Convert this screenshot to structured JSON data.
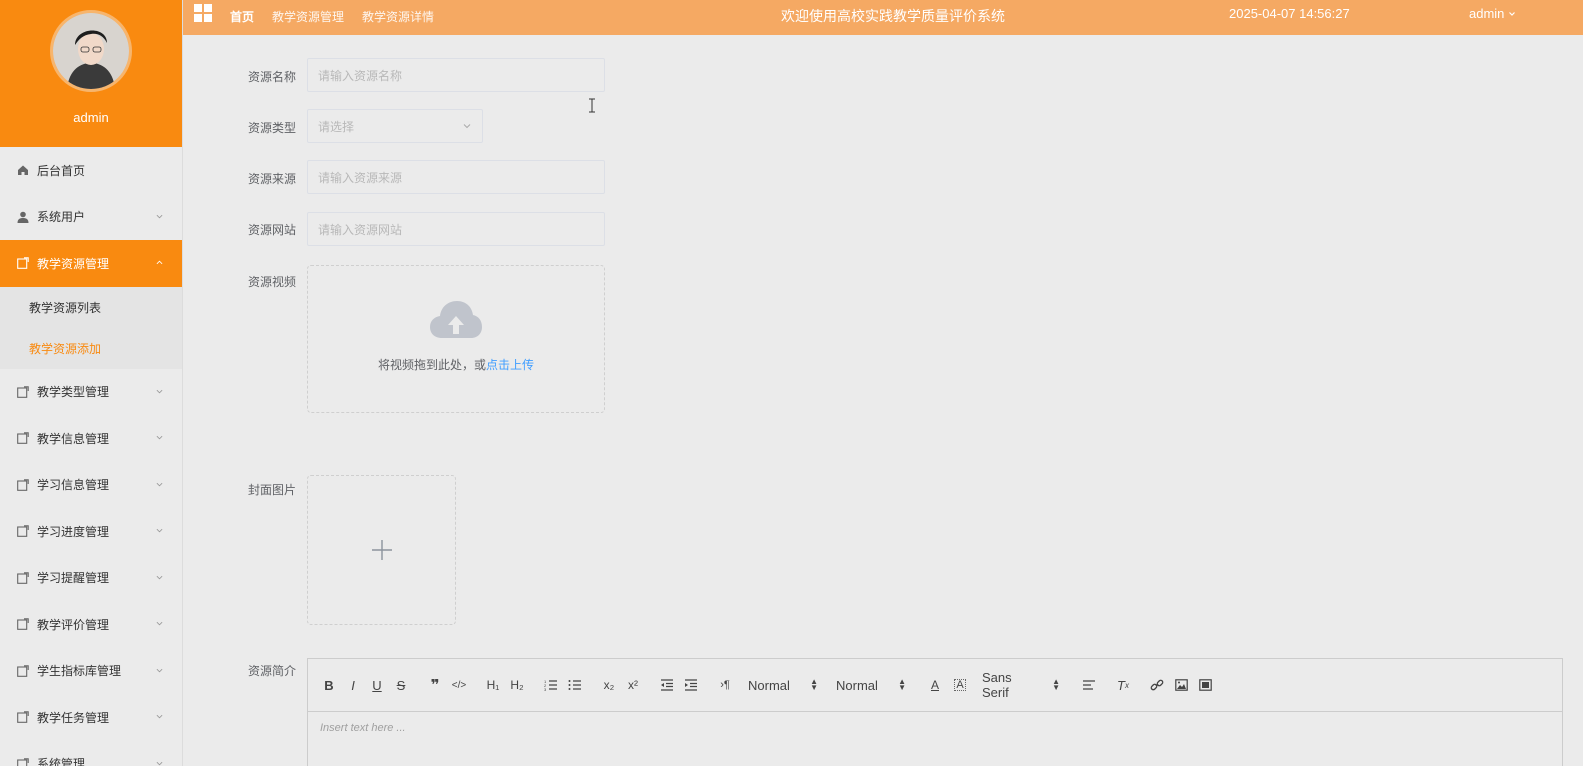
{
  "sidebar": {
    "username": "admin",
    "menu": [
      {
        "label": "后台首页",
        "icon": "home-icon"
      },
      {
        "label": "系统用户",
        "icon": "user-icon"
      },
      {
        "label": "教学资源管理",
        "icon": "edit-icon",
        "active": true,
        "submenu": [
          {
            "label": "教学资源列表"
          },
          {
            "label": "教学资源添加",
            "current": true
          }
        ]
      },
      {
        "label": "教学类型管理",
        "icon": "edit-icon"
      },
      {
        "label": "教学信息管理",
        "icon": "edit-icon"
      },
      {
        "label": "学习信息管理",
        "icon": "edit-icon"
      },
      {
        "label": "学习进度管理",
        "icon": "edit-icon"
      },
      {
        "label": "学习提醒管理",
        "icon": "edit-icon"
      },
      {
        "label": "教学评价管理",
        "icon": "edit-icon"
      },
      {
        "label": "学生指标库管理",
        "icon": "edit-icon"
      },
      {
        "label": "教学任务管理",
        "icon": "edit-icon"
      },
      {
        "label": "系统管理",
        "icon": "edit-icon"
      }
    ]
  },
  "topbar": {
    "breadcrumbs": [
      "首页",
      "教学资源管理",
      "教学资源详情"
    ],
    "title": "欢迎使用高校实践教学质量评价系统",
    "datetime": "2025-04-07 14:56:27",
    "user": "admin"
  },
  "form": {
    "name_label": "资源名称",
    "name_placeholder": "请输入资源名称",
    "type_label": "资源类型",
    "type_placeholder": "请选择",
    "source_label": "资源来源",
    "source_placeholder": "请输入资源来源",
    "site_label": "资源网站",
    "site_placeholder": "请输入资源网站",
    "video_label": "资源视频",
    "upload_hint": "将视频拖到此处，或",
    "upload_link": "点击上传",
    "cover_label": "封面图片",
    "intro_label": "资源简介"
  },
  "editor": {
    "header_select": "Normal",
    "size_select": "Normal",
    "font_select": "Sans Serif",
    "placeholder": "Insert text here ..."
  },
  "colors": {
    "accent": "#f98a10",
    "topbar": "#f5a963",
    "link": "#409eff"
  }
}
